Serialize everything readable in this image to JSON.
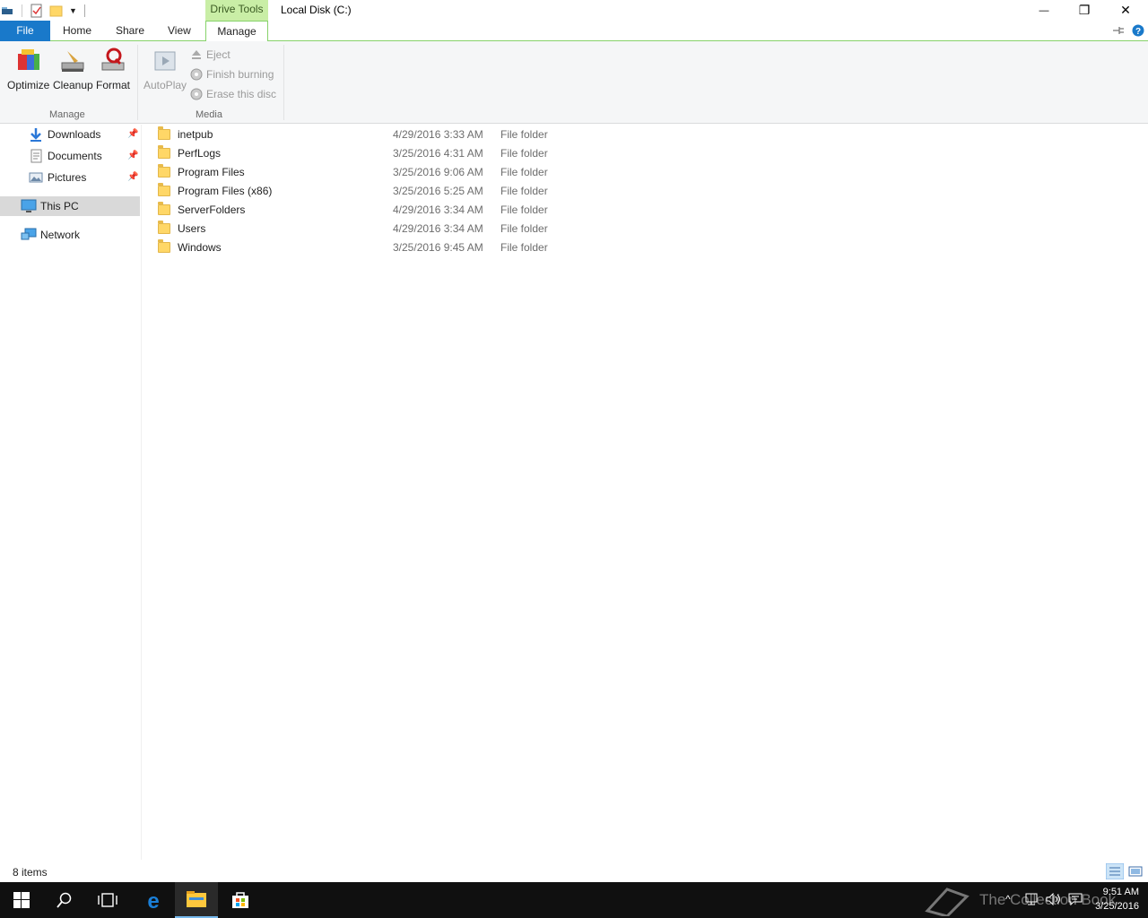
{
  "titlebar": {
    "title": "Local Disk (C:)",
    "contextual_tab": "Drive Tools",
    "caption_buttons": {
      "minimize": "—",
      "restore": "❐",
      "close": "✕"
    }
  },
  "ribbon": {
    "tabs": {
      "file": "File",
      "home": "Home",
      "share": "Share",
      "view": "View",
      "manage": "Manage"
    },
    "manage_group": {
      "label": "Manage",
      "optimize": "Optimize",
      "cleanup": "Cleanup",
      "format": "Format"
    },
    "media_group": {
      "label": "Media",
      "autoplay": "AutoPlay",
      "eject": "Eject",
      "finish_burning": "Finish burning",
      "erase_disc": "Erase this disc"
    }
  },
  "nav": {
    "downloads": "Downloads",
    "documents": "Documents",
    "pictures": "Pictures",
    "this_pc": "This PC",
    "network": "Network"
  },
  "files": [
    {
      "name": "inetpub",
      "date": "4/29/2016 3:33 AM",
      "type": "File folder"
    },
    {
      "name": "PerfLogs",
      "date": "3/25/2016 4:31 AM",
      "type": "File folder"
    },
    {
      "name": "Program Files",
      "date": "3/25/2016 9:06 AM",
      "type": "File folder"
    },
    {
      "name": "Program Files (x86)",
      "date": "3/25/2016 5:25 AM",
      "type": "File folder"
    },
    {
      "name": "ServerFolders",
      "date": "4/29/2016 3:34 AM",
      "type": "File folder"
    },
    {
      "name": "Users",
      "date": "4/29/2016 3:34 AM",
      "type": "File folder"
    },
    {
      "name": "Windows",
      "date": "3/25/2016 9:45 AM",
      "type": "File folder"
    }
  ],
  "status": {
    "item_count": "8 items"
  },
  "taskbar": {
    "watermark": "The Collection Book",
    "time": "9:51 AM",
    "date": "3/25/2016"
  },
  "colors": {
    "file_tab": "#1979ca",
    "contextual": "#c9eea6",
    "selected_nav": "#d9d9d9"
  }
}
